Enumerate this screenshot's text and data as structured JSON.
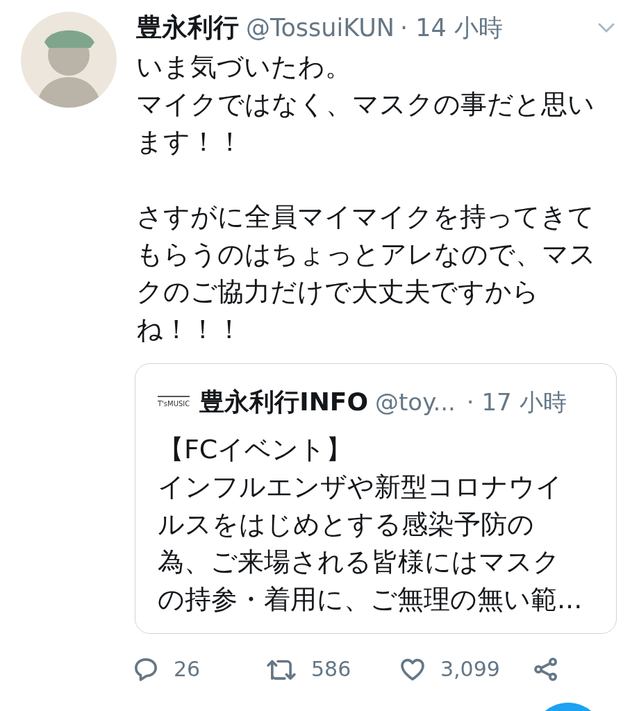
{
  "tweet": {
    "author": {
      "name": "豊永利行",
      "handle": "@TossuiKUN",
      "time": "· 14 小時"
    },
    "paragraphs": [
      [
        "いま気づいたわ。",
        "マイクではなく、マスクの事だと思い",
        "ます！！"
      ],
      [
        "さすがに全員マイマイクを持ってきて",
        "もらうのはちょっとアレなので、マス",
        "クのご協力だけで大丈夫ですから",
        "ね！！！"
      ]
    ],
    "quoted": {
      "logo_text": "T'sMUSIC",
      "name": "豊永利行INFO",
      "handle": "@toy...",
      "time": "· 17 小時",
      "text": [
        "【FCイベント】",
        "インフルエンザや新型コロナウイ",
        "ルスをはじめとする感染予防の",
        "為、ご来場される皆様にはマスク",
        "の持参・着用に、ご無理の無い範..."
      ]
    },
    "actions": [
      {
        "kind": "reply",
        "count": "26"
      },
      {
        "kind": "retweet",
        "count": "586"
      },
      {
        "kind": "like",
        "count": "3,099"
      },
      {
        "kind": "share"
      }
    ]
  }
}
